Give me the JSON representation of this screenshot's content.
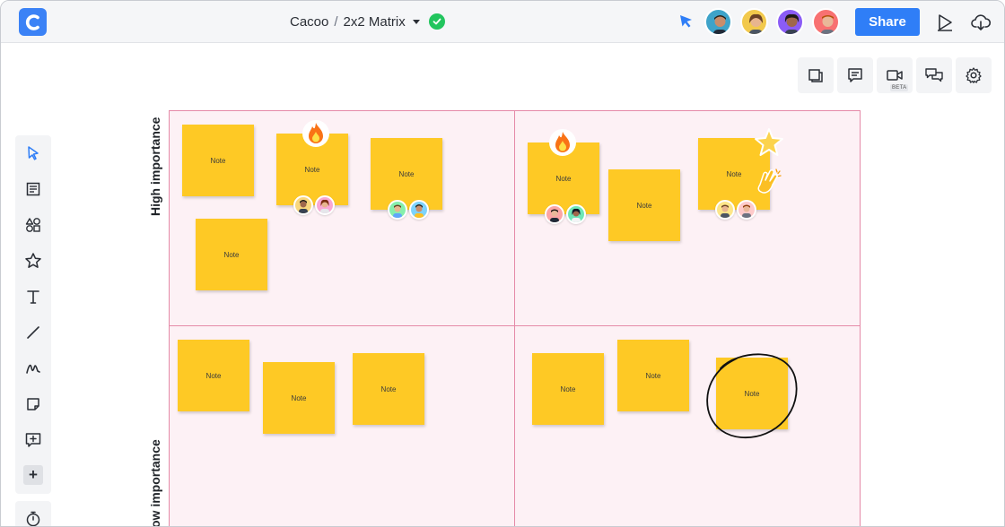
{
  "header": {
    "breadcrumb_root": "Cacoo",
    "separator": "/",
    "doc_title": "2x2 Matrix",
    "share_label": "Share",
    "brand_color": "#3b82f6",
    "share_color": "#2f7ef7"
  },
  "toolbar_top": {
    "beta_label": "BETA",
    "items": [
      "pages-icon",
      "comment-icon",
      "video-icon",
      "chat-icon",
      "settings-icon"
    ]
  },
  "toolbar_left": {
    "items": [
      "pointer-icon",
      "text-block-icon",
      "shapes-icon",
      "star-icon",
      "text-icon",
      "line-icon",
      "pen-icon",
      "sticky-note-icon",
      "add-comment-icon",
      "plus-icon",
      "timer-icon"
    ],
    "plus_label": "+"
  },
  "matrix": {
    "high_label": "High importance",
    "low_label": "ow importance",
    "border_color": "#e58aa8",
    "fill_color": "#fdf1f5"
  },
  "note_label": "Note",
  "note_color": "#fec925"
}
